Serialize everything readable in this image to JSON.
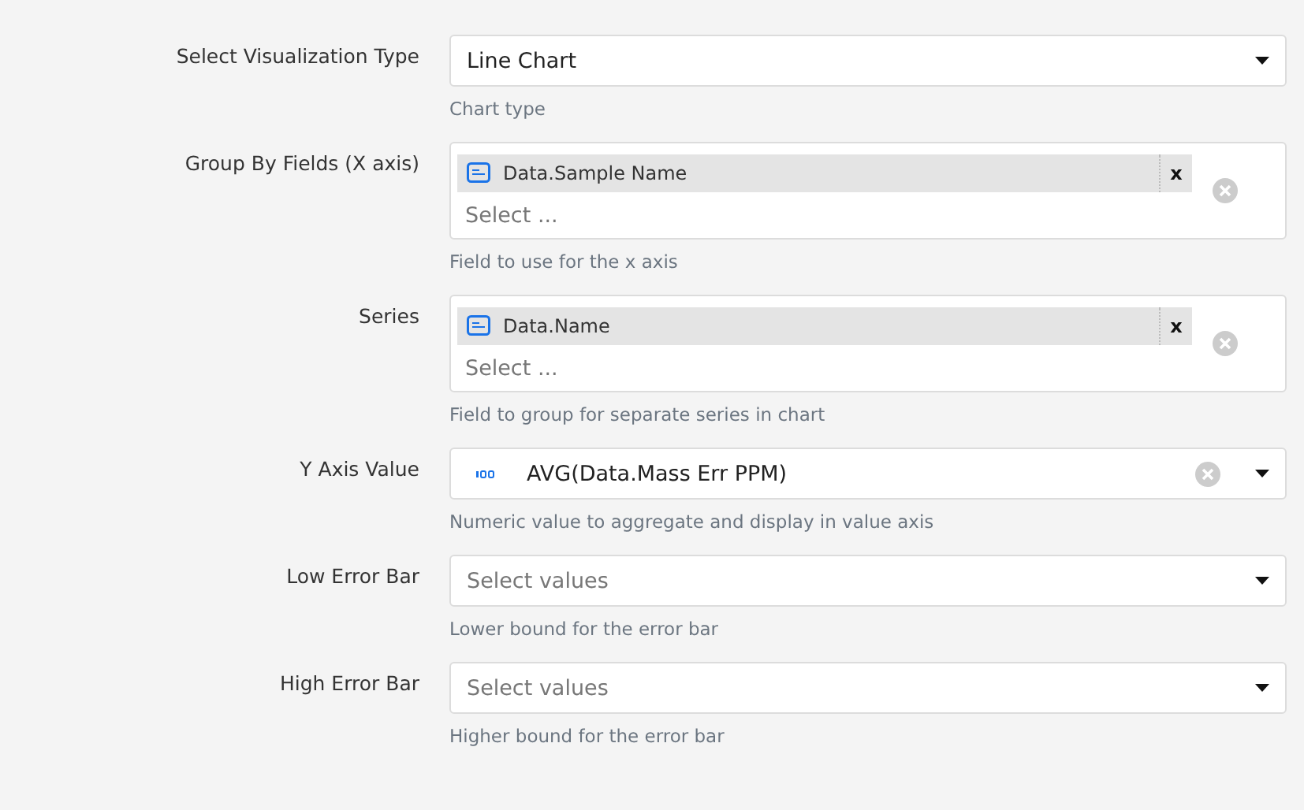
{
  "fields": [
    {
      "label": "Select Visualization Type",
      "kind": "select",
      "value": "Line Chart",
      "clearable": false,
      "help": "Chart type"
    },
    {
      "label": "Group By Fields (X axis)",
      "kind": "multi",
      "tags": [
        {
          "label": "Data.Sample Name",
          "remove": "x"
        }
      ],
      "placeholder": "Select ...",
      "help": "Field to use for the x axis"
    },
    {
      "label": "Series",
      "kind": "multi",
      "tags": [
        {
          "label": "Data.Name",
          "remove": "x"
        }
      ],
      "placeholder": "Select ...",
      "help": "Field to group for separate series in chart"
    },
    {
      "label": "Y Axis Value",
      "kind": "numeric-select",
      "value": "AVG(Data.Mass Err PPM)",
      "clearable": true,
      "help": "Numeric value to aggregate and display in value axis"
    },
    {
      "label": "Low Error Bar",
      "kind": "select",
      "placeholder": "Select values",
      "clearable": false,
      "help": "Lower bound for the error bar"
    },
    {
      "label": "High Error Bar",
      "kind": "select",
      "placeholder": "Select values",
      "clearable": false,
      "help": "Higher bound for the error bar"
    }
  ]
}
